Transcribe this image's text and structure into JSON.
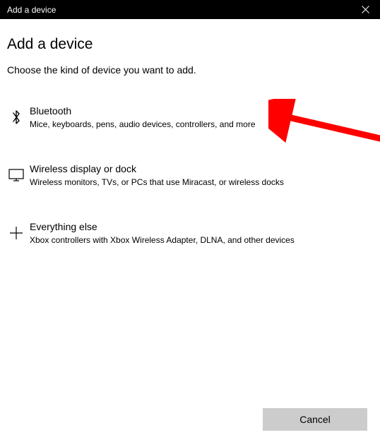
{
  "titlebar": {
    "title": "Add a device"
  },
  "header": {
    "heading": "Add a device",
    "subheading": "Choose the kind of device you want to add."
  },
  "options": [
    {
      "title": "Bluetooth",
      "description": "Mice, keyboards, pens, audio devices, controllers, and more"
    },
    {
      "title": "Wireless display or dock",
      "description": "Wireless monitors, TVs, or PCs that use Miracast, or wireless docks"
    },
    {
      "title": "Everything else",
      "description": "Xbox controllers with Xbox Wireless Adapter, DLNA, and other devices"
    }
  ],
  "footer": {
    "cancel_label": "Cancel"
  }
}
